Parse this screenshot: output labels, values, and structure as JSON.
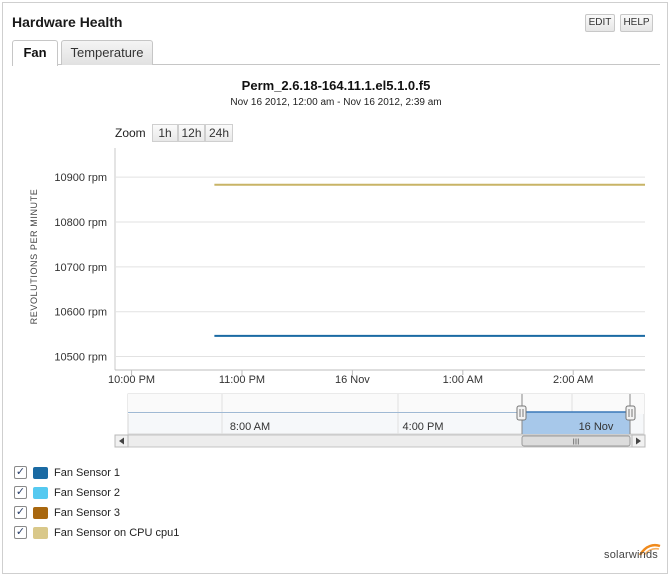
{
  "header": {
    "title": "Hardware Health",
    "edit_label": "EDIT",
    "help_label": "HELP"
  },
  "tabs": [
    {
      "label": "Fan",
      "active": true
    },
    {
      "label": "Temperature",
      "active": false
    }
  ],
  "chart_header": {
    "title": "Perm_2.6.18-164.11.1.el5.1.0.f5",
    "subtitle": "Nov 16 2012, 12:00 am - Nov 16 2012, 2:39 am"
  },
  "zoom": {
    "label": "Zoom",
    "options": [
      "1h",
      "12h",
      "24h"
    ]
  },
  "navigator": {
    "tick_labels": [
      "8:00 AM",
      "4:00 PM",
      "16 Nov"
    ],
    "scroll_grip": "III"
  },
  "legend": [
    {
      "label": "Fan Sensor 1",
      "color": "#1a6aa3",
      "checked": true
    },
    {
      "label": "Fan Sensor 2",
      "color": "#55c9f0",
      "checked": true
    },
    {
      "label": "Fan Sensor 3",
      "color": "#a8670f",
      "checked": true
    },
    {
      "label": "Fan Sensor on CPU cpu1",
      "color": "#d9c88a",
      "checked": true
    }
  ],
  "logo_text": "solarwinds",
  "colors": {
    "accent_orange": "#f08a1c",
    "grid": "#e2e2e2",
    "navigator_selection": "#a7c8ea"
  },
  "chart_data": {
    "type": "line",
    "ylabel": "REVOLUTIONS PER MINUTE",
    "y_ticks": [
      "10500 rpm",
      "10600 rpm",
      "10700 rpm",
      "10800 rpm",
      "10900 rpm"
    ],
    "y_tick_values": [
      10500,
      10600,
      10700,
      10800,
      10900
    ],
    "x_ticks": [
      "10:00 PM",
      "11:00 PM",
      "16 Nov",
      "1:00 AM",
      "2:00 AM"
    ],
    "x_tick_hours": [
      -2,
      -1,
      0,
      1,
      2
    ],
    "xlim_hours": [
      -2.15,
      2.65
    ],
    "ylim": [
      10470,
      10965
    ],
    "series": [
      {
        "name": "Fan Sensor on CPU cpu1",
        "color": "#c8b466",
        "x_hours": [
          -1.25,
          2.65
        ],
        "values": [
          10883,
          10883
        ]
      },
      {
        "name": "Fan Sensor 1",
        "color": "#1a6aa3",
        "x_hours": [
          -1.25,
          2.65
        ],
        "values": [
          10546,
          10546
        ]
      }
    ]
  }
}
